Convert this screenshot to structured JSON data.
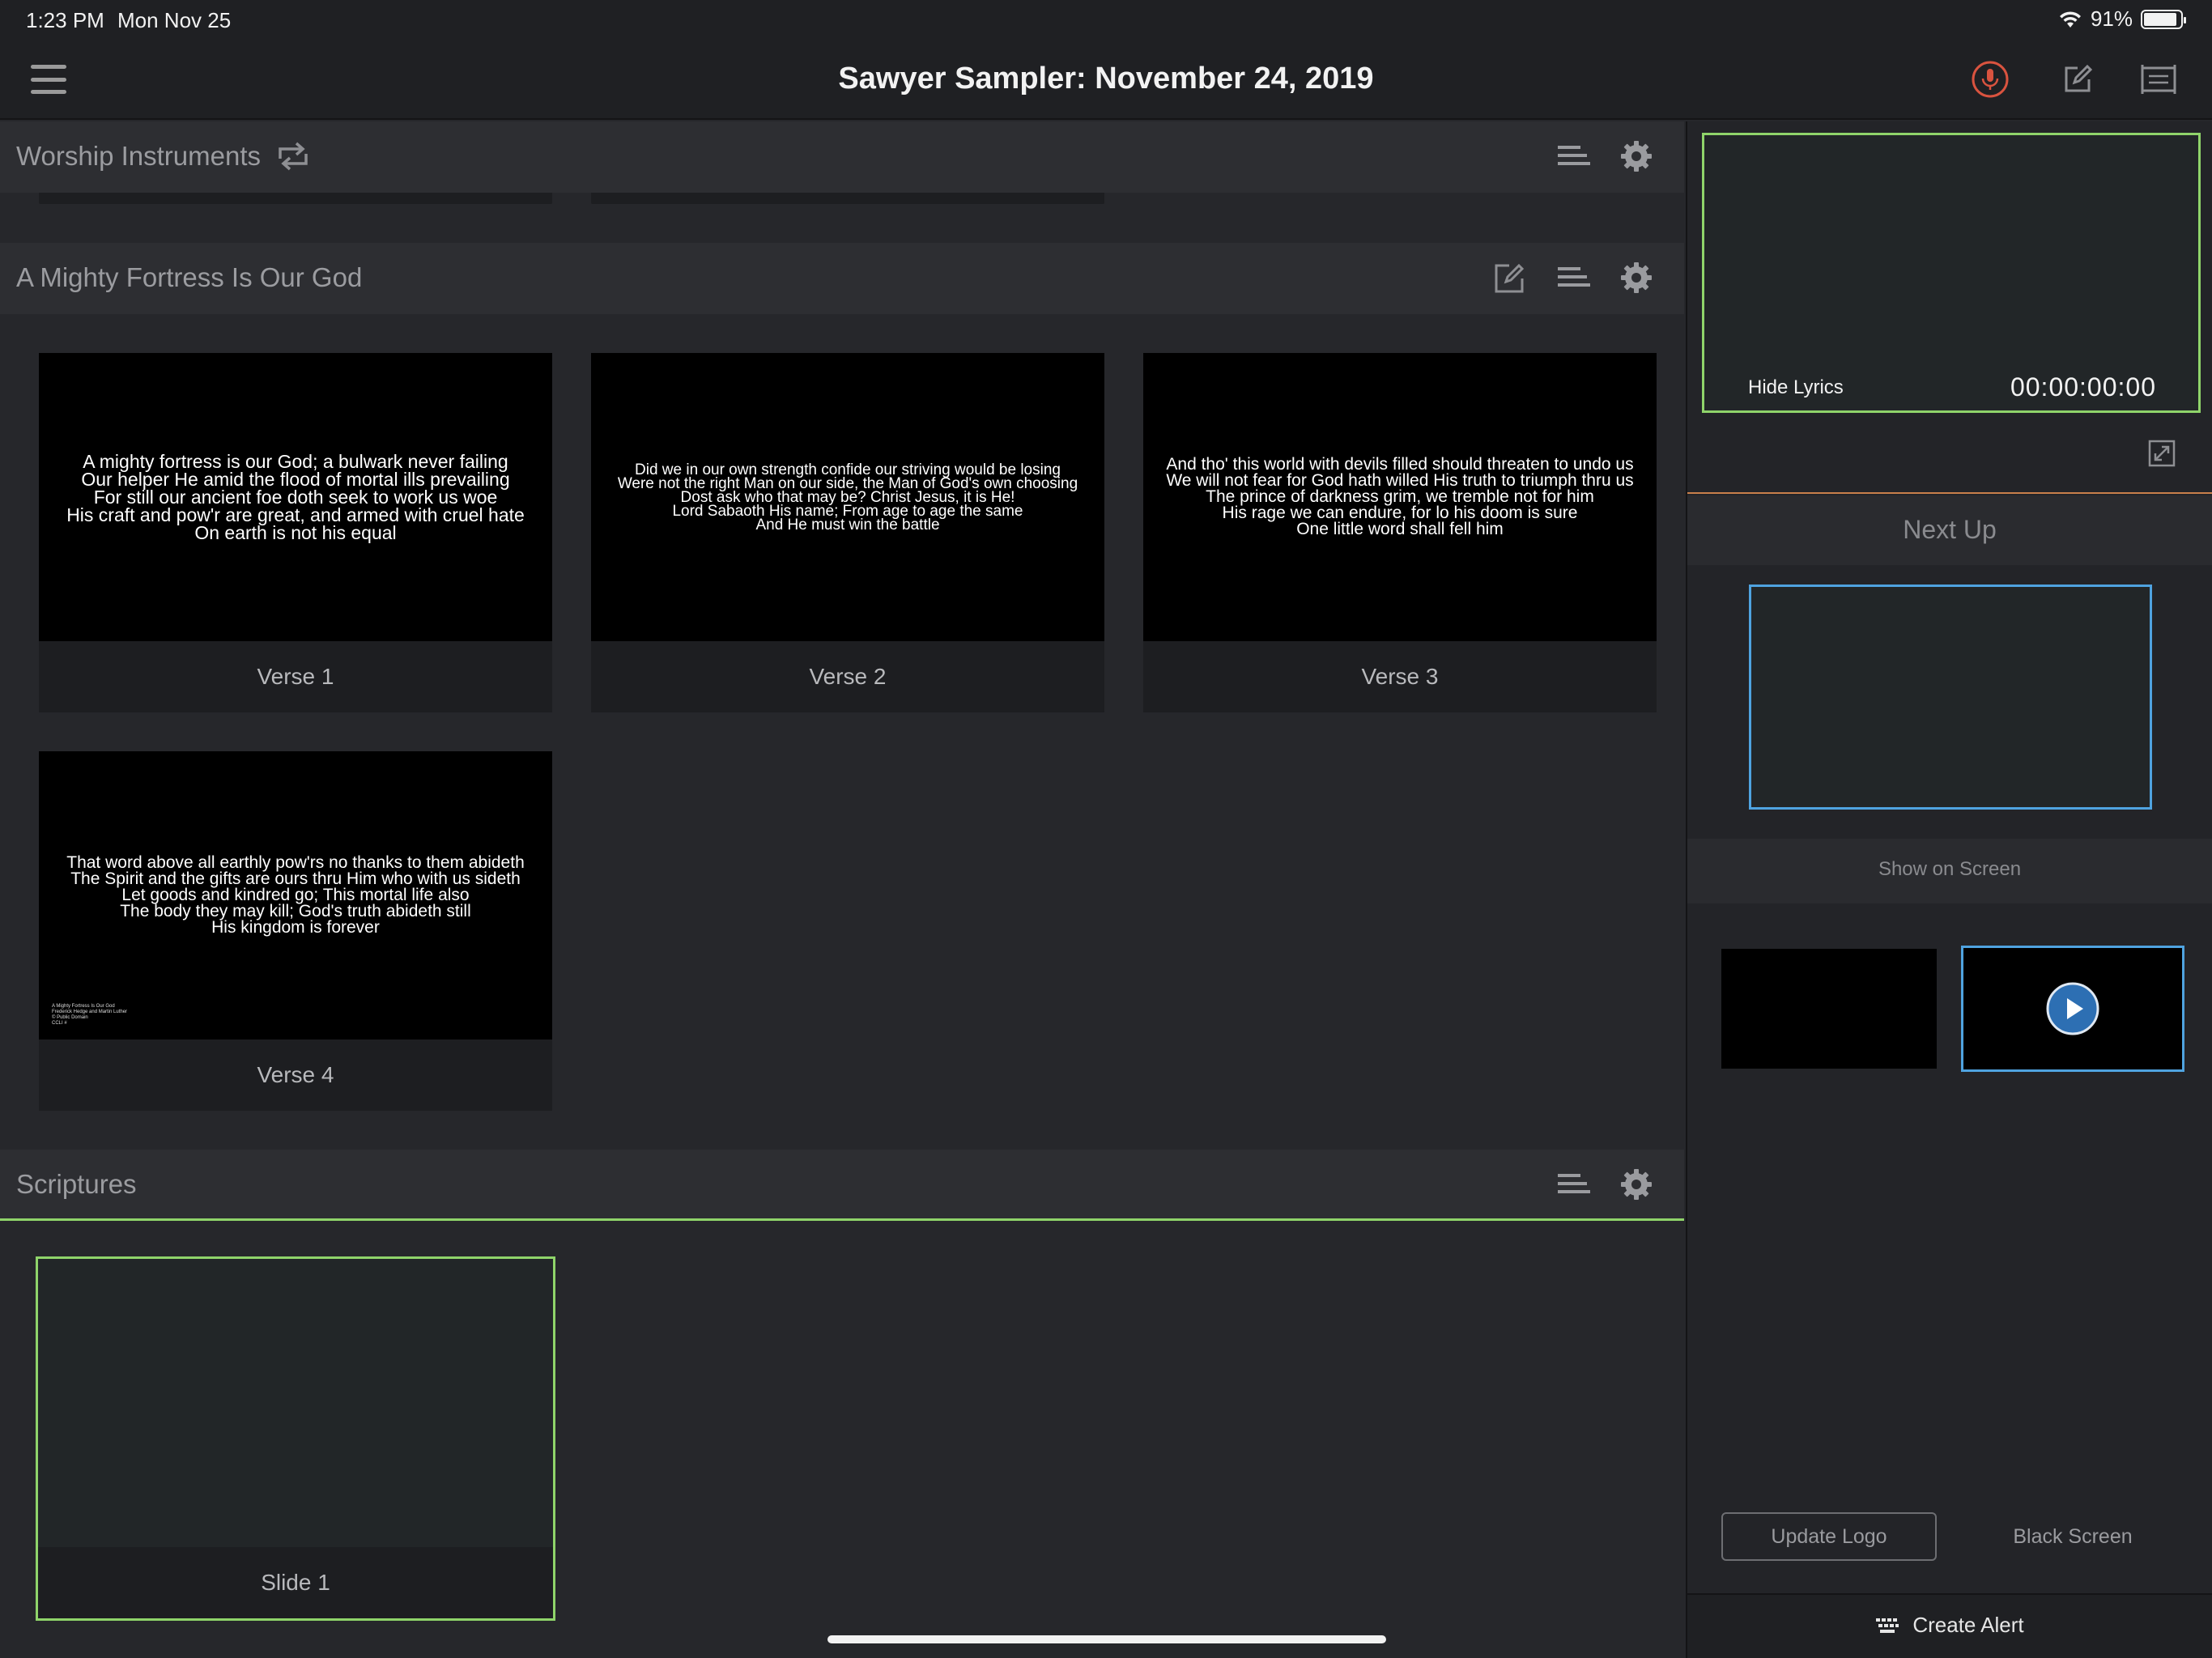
{
  "status_bar": {
    "time": "1:23 PM",
    "date": "Mon Nov 25",
    "battery": "91%",
    "battery_level": 0.91
  },
  "nav": {
    "title": "Sawyer Sampler: November 24, 2019",
    "icons": [
      "menu-icon",
      "microphone-icon",
      "edit-icon",
      "screen-icon"
    ],
    "mic_color": "#d9533f"
  },
  "sections": {
    "worship": {
      "title": "Worship Instruments"
    },
    "fortress": {
      "title": "A Mighty Fortress Is Our God"
    },
    "scriptures": {
      "title": "Scriptures"
    }
  },
  "slides": [
    {
      "label": "Verse 1",
      "lyrics": "A mighty fortress is our God; a bulwark never failing\nOur helper He amid the flood of mortal ills prevailing\nFor still our ancient foe doth seek to work us woe\nHis craft and pow'r are great, and armed with cruel hate\nOn earth is not his equal"
    },
    {
      "label": "Verse 2",
      "lyrics": "Did we in our own strength confide our striving would be losing\nWere not the right Man on our side, the Man of God's own choosing\nDost ask who that may be? Christ Jesus, it is He!\nLord Sabaoth His name; From age to age the same\nAnd He must win the battle"
    },
    {
      "label": "Verse 3",
      "lyrics": "And tho' this world with devils filled should threaten to undo us\nWe will not fear for God hath willed His truth to triumph thru us\nThe prince of darkness grim, we tremble not for him\nHis rage we can endure, for lo his doom is sure\nOne little word shall fell him"
    },
    {
      "label": "Verse 4",
      "lyrics": "That word above all earthly pow'rs no thanks to them abideth\nThe Spirit and the gifts are ours thru Him who with us sideth\nLet goods and kindred go; This mortal life also\nThe body they may kill; God's truth abideth still\nHis kingdom is forever",
      "credits": "A Mighty Fortress Is Our God\nFrederick Hedge and Martin Luther\n© Public Domain\nCCLI #"
    }
  ],
  "scripture_slide": {
    "label": "Slide 1"
  },
  "right_panel": {
    "hide_lyrics": "Hide Lyrics",
    "timer": "00:00:00:00",
    "next_up": "Next Up",
    "show_on_screen": "Show on Screen",
    "update_logo": "Update Logo",
    "black_screen": "Black Screen",
    "create_alert": "Create Alert"
  },
  "colors": {
    "live_border": "#8fd46a",
    "next_border": "#4fa3e0",
    "divider": "#c9804b"
  }
}
